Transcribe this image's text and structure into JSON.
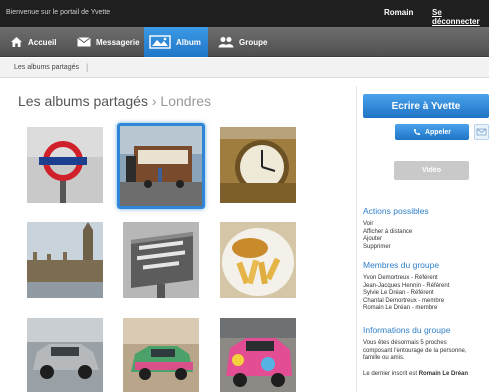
{
  "topbar": {
    "welcome": "Bienvenue sur le portail de Yvette",
    "user": "Romain",
    "logout": "Se déconnecter"
  },
  "nav": {
    "items": [
      {
        "label": "Accueil",
        "icon": "home-icon"
      },
      {
        "label": "Messagerie",
        "icon": "envelope-icon"
      },
      {
        "label": "Album",
        "icon": "photo-album-icon",
        "active": true
      },
      {
        "label": "Groupe",
        "icon": "group-icon"
      }
    ]
  },
  "breadcrumb": {
    "item": "Les albums partagés"
  },
  "album": {
    "title": "Les albums partagés",
    "separator": "›",
    "city": "Londres",
    "photos": [
      {
        "subject": "underground-sign"
      },
      {
        "subject": "street-market-stall",
        "selected": true
      },
      {
        "subject": "big-ben-clock"
      },
      {
        "subject": "parliament"
      },
      {
        "subject": "new-scotland-yard-sign"
      },
      {
        "subject": "fish-and-chips"
      },
      {
        "subject": "silver-taxi"
      },
      {
        "subject": "painted-taxi-street"
      },
      {
        "subject": "pink-taxi"
      }
    ]
  },
  "sidebar": {
    "write_button": "Ecrire à Yvette",
    "call_button": "Appeler",
    "video_button": "Vidéo",
    "actions": {
      "title": "Actions possibles",
      "items": [
        "Voir",
        "Afficher à distance",
        "Ajouter",
        "Supprimer"
      ]
    },
    "members": {
      "title": "Membres du groupe",
      "items": [
        "Yvon Demortreux - Référent",
        "Jean-Jacques Hennin - Référent",
        "Sylvie Le Dréan - Référent",
        "Chantal Demortreux - membre",
        "Romain Le Dréan - membre"
      ]
    },
    "info": {
      "title": "Informations du groupe",
      "text_line1": "Vous êtes désormais 5 proches",
      "text_line2": "composant l'entourage de la personne,",
      "text_line3": "famille ou amis.",
      "last_prefix": "Le dernier inscrit est",
      "last_name": "Romain Le Dréan"
    }
  },
  "colors": {
    "accent": "#2f86d6",
    "topbar": "#1f1f1f",
    "nav": "#5a5a5a"
  }
}
